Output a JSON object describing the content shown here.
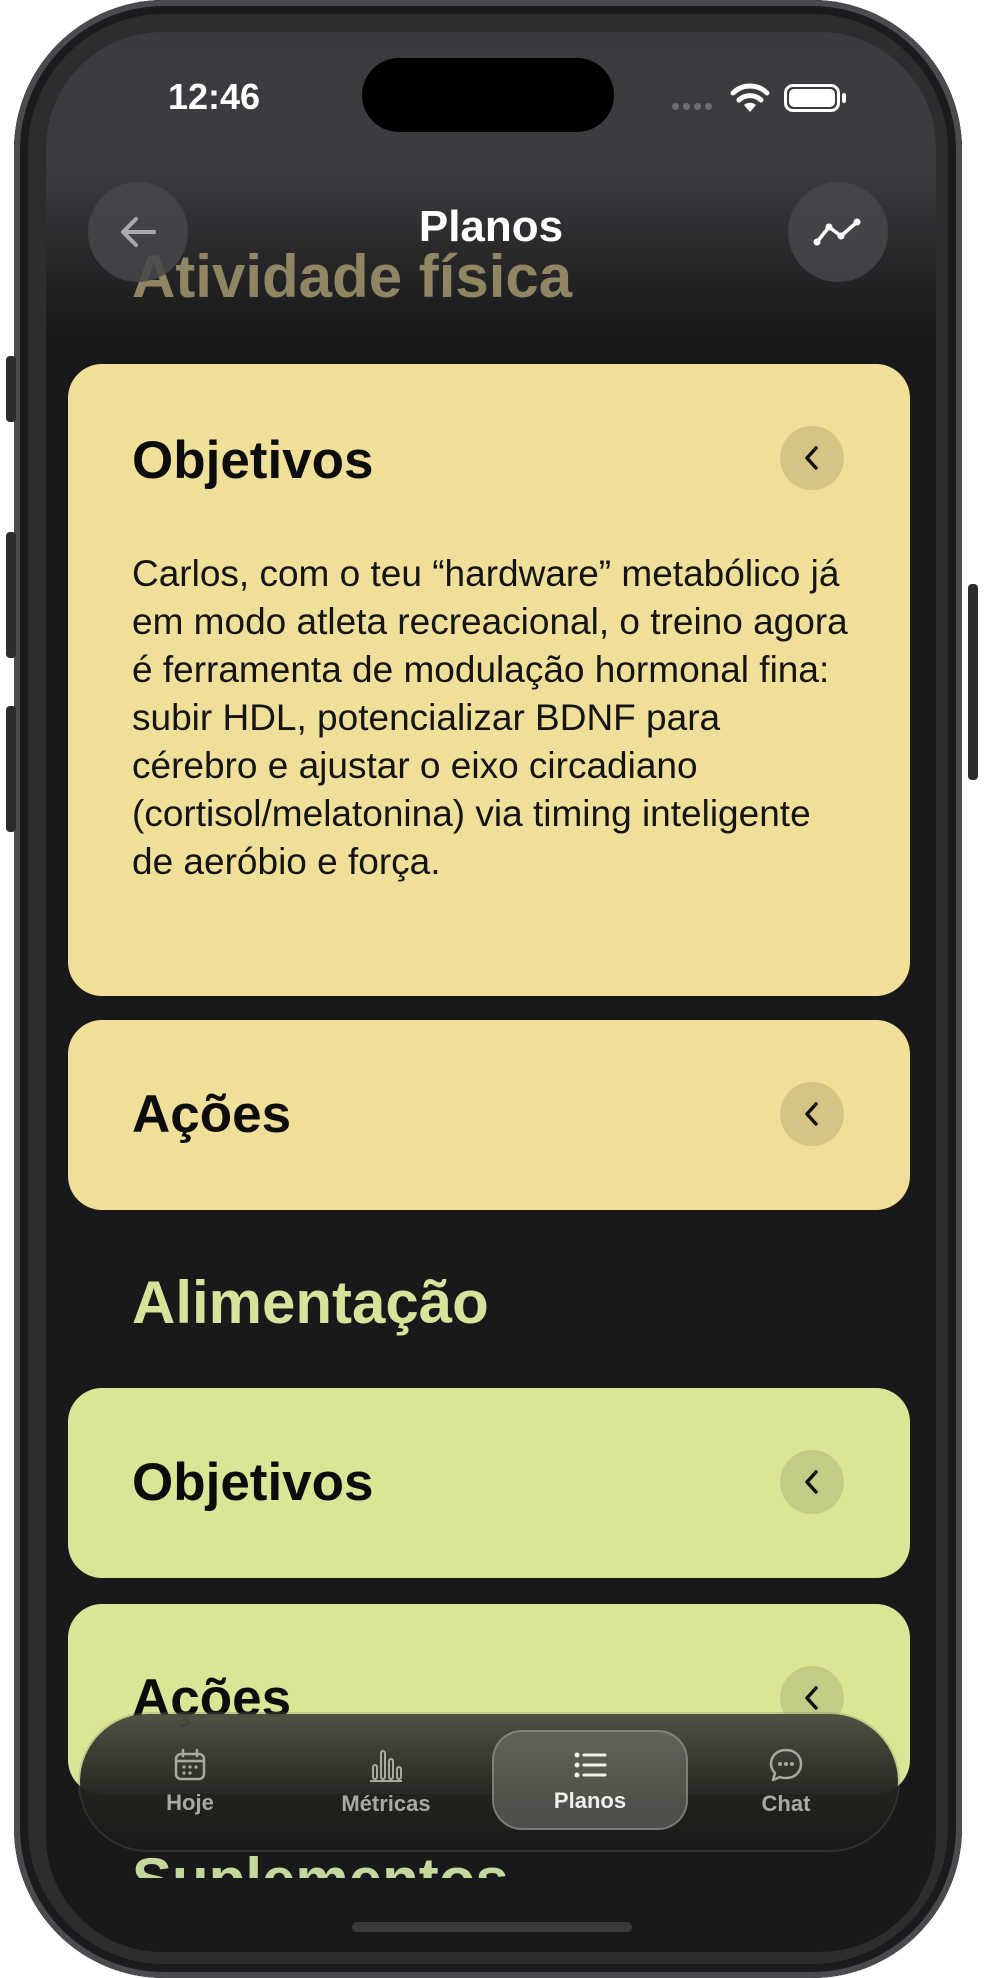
{
  "status": {
    "time": "12:46"
  },
  "nav": {
    "title": "Planos",
    "back_icon": "arrow-left-icon",
    "trend_icon": "trend-line-icon"
  },
  "sections": [
    {
      "title": "Atividade física",
      "color": "#efdf98",
      "cards": [
        {
          "title": "Objetivos",
          "body": "Carlos, com o teu “hardware” metabólico já em modo atleta recreacional, o treino agora é ferramenta de modulação hormonal fina: subir HDL, potencializar BDNF para cérebro e ajustar o eixo circadiano (cortisol/melatonina) via timing inteligente de aeróbio e força."
        },
        {
          "title": "Ações"
        }
      ]
    },
    {
      "title": "Alimentação",
      "color": "#dbe596",
      "cards": [
        {
          "title": "Objetivos"
        },
        {
          "title": "Ações"
        }
      ]
    },
    {
      "title": "Suplementos"
    }
  ],
  "tabbar": {
    "tabs": [
      {
        "label": "Hoje",
        "icon": "calendar-icon"
      },
      {
        "label": "Métricas",
        "icon": "bar-chart-icon"
      },
      {
        "label": "Planos",
        "icon": "list-icon",
        "active": true
      },
      {
        "label": "Chat",
        "icon": "chat-bubble-icon"
      }
    ]
  }
}
